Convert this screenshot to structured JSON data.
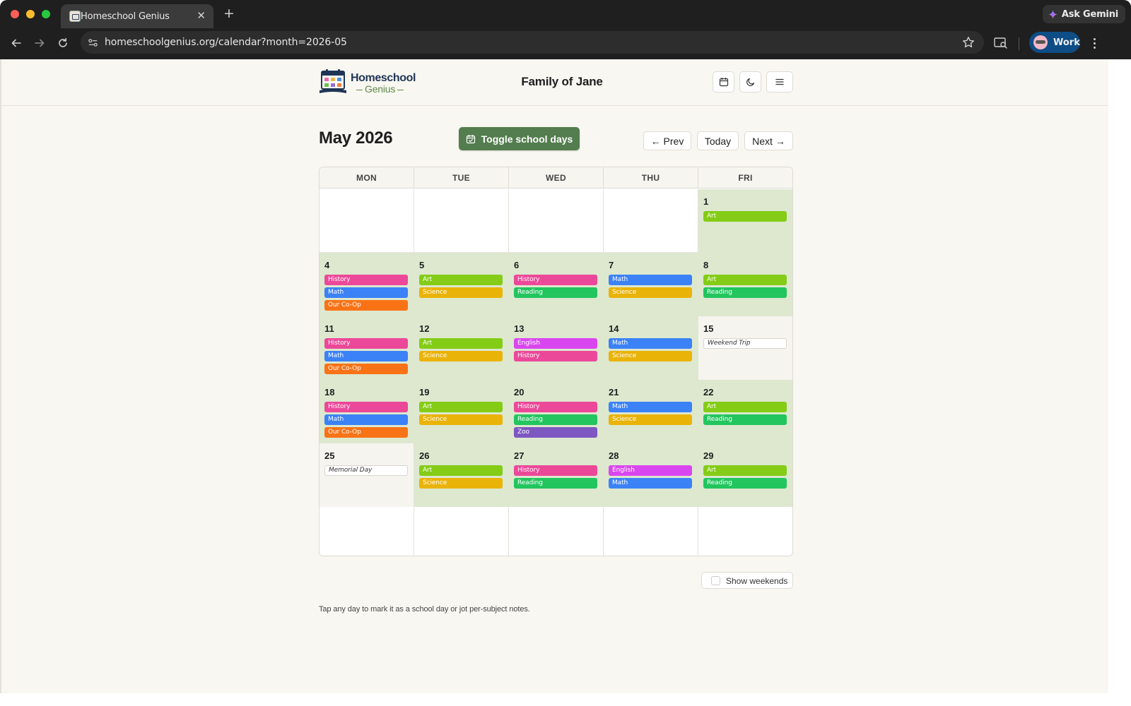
{
  "browser": {
    "tab_title": "Homeschool Genius",
    "tab_close": "✕",
    "new_tab": "+",
    "gemini_label": "Ask Gemini",
    "url": "homeschoolgenius.org/calendar?month=2026-05",
    "profile_label": "Work"
  },
  "header": {
    "logo_line1": "Homeschool",
    "logo_line2": "Genius",
    "family_name": "Family of Jane",
    "icons": [
      "calendar-icon",
      "moon-icon",
      "menu-icon"
    ]
  },
  "calendar": {
    "month_title": "May 2026",
    "toggle_label": "Toggle school days",
    "prev_label": "← Prev",
    "today_label": "Today",
    "next_label": "Next →",
    "weekdays": [
      "MON",
      "TUE",
      "WED",
      "THU",
      "FRI"
    ],
    "weeks": [
      [
        {
          "day": "",
          "type": "blank",
          "chips": []
        },
        {
          "day": "",
          "type": "blank",
          "chips": []
        },
        {
          "day": "",
          "type": "blank",
          "chips": []
        },
        {
          "day": "",
          "type": "blank",
          "chips": []
        },
        {
          "day": "1",
          "type": "school",
          "chips": [
            {
              "label": "Art",
              "subject": "art"
            }
          ]
        }
      ],
      [
        {
          "day": "4",
          "type": "school",
          "chips": [
            {
              "label": "History",
              "subject": "history"
            },
            {
              "label": "Math",
              "subject": "math"
            },
            {
              "label": "Our Co-Op",
              "subject": "coop"
            }
          ]
        },
        {
          "day": "5",
          "type": "school",
          "chips": [
            {
              "label": "Art",
              "subject": "art"
            },
            {
              "label": "Science",
              "subject": "science"
            }
          ]
        },
        {
          "day": "6",
          "type": "school",
          "chips": [
            {
              "label": "History",
              "subject": "history"
            },
            {
              "label": "Reading",
              "subject": "reading"
            }
          ]
        },
        {
          "day": "7",
          "type": "school",
          "chips": [
            {
              "label": "Math",
              "subject": "math"
            },
            {
              "label": "Science",
              "subject": "science"
            }
          ]
        },
        {
          "day": "8",
          "type": "school",
          "chips": [
            {
              "label": "Art",
              "subject": "art"
            },
            {
              "label": "Reading",
              "subject": "reading"
            }
          ]
        }
      ],
      [
        {
          "day": "11",
          "type": "school",
          "chips": [
            {
              "label": "History",
              "subject": "history"
            },
            {
              "label": "Math",
              "subject": "math"
            },
            {
              "label": "Our Co-Op",
              "subject": "coop"
            }
          ]
        },
        {
          "day": "12",
          "type": "school",
          "chips": [
            {
              "label": "Art",
              "subject": "art"
            },
            {
              "label": "Science",
              "subject": "science"
            }
          ]
        },
        {
          "day": "13",
          "type": "school",
          "chips": [
            {
              "label": "English",
              "subject": "english"
            },
            {
              "label": "History",
              "subject": "history"
            }
          ]
        },
        {
          "day": "14",
          "type": "school",
          "chips": [
            {
              "label": "Math",
              "subject": "math"
            },
            {
              "label": "Science",
              "subject": "science"
            }
          ]
        },
        {
          "day": "15",
          "type": "offday",
          "chips": [
            {
              "label": "Weekend Trip",
              "subject": "note"
            }
          ]
        }
      ],
      [
        {
          "day": "18",
          "type": "school",
          "chips": [
            {
              "label": "History",
              "subject": "history"
            },
            {
              "label": "Math",
              "subject": "math"
            },
            {
              "label": "Our Co-Op",
              "subject": "coop"
            }
          ]
        },
        {
          "day": "19",
          "type": "school",
          "chips": [
            {
              "label": "Art",
              "subject": "art"
            },
            {
              "label": "Science",
              "subject": "science"
            }
          ]
        },
        {
          "day": "20",
          "type": "school",
          "chips": [
            {
              "label": "History",
              "subject": "history"
            },
            {
              "label": "Reading",
              "subject": "reading"
            },
            {
              "label": "Zoo",
              "subject": "zoo"
            }
          ]
        },
        {
          "day": "21",
          "type": "school",
          "chips": [
            {
              "label": "Math",
              "subject": "math"
            },
            {
              "label": "Science",
              "subject": "science"
            }
          ]
        },
        {
          "day": "22",
          "type": "school",
          "chips": [
            {
              "label": "Art",
              "subject": "art"
            },
            {
              "label": "Reading",
              "subject": "reading"
            }
          ]
        }
      ],
      [
        {
          "day": "25",
          "type": "offday",
          "chips": [
            {
              "label": "Memorial Day",
              "subject": "note"
            }
          ]
        },
        {
          "day": "26",
          "type": "school",
          "chips": [
            {
              "label": "Art",
              "subject": "art"
            },
            {
              "label": "Science",
              "subject": "science"
            }
          ]
        },
        {
          "day": "27",
          "type": "school",
          "chips": [
            {
              "label": "History",
              "subject": "history"
            },
            {
              "label": "Reading",
              "subject": "reading"
            }
          ]
        },
        {
          "day": "28",
          "type": "school",
          "chips": [
            {
              "label": "English",
              "subject": "english"
            },
            {
              "label": "Math",
              "subject": "math"
            }
          ]
        },
        {
          "day": "29",
          "type": "school",
          "chips": [
            {
              "label": "Art",
              "subject": "art"
            },
            {
              "label": "Reading",
              "subject": "reading"
            }
          ]
        }
      ],
      [
        {
          "day": "",
          "type": "blank",
          "chips": []
        },
        {
          "day": "",
          "type": "blank",
          "chips": []
        },
        {
          "day": "",
          "type": "blank",
          "chips": []
        },
        {
          "day": "",
          "type": "blank",
          "chips": []
        },
        {
          "day": "",
          "type": "blank",
          "chips": []
        }
      ]
    ],
    "subject_colors": {
      "art": "#84cc16",
      "science": "#eab308",
      "history": "#ec4899",
      "math": "#3b82f6",
      "coop": "#f97316",
      "reading": "#22c55e",
      "english": "#d946ef",
      "zoo": "#7e57c2"
    },
    "school_day_color": "#dde8cf",
    "show_weekends_label": "Show weekends",
    "show_weekends_checked": false,
    "hint": "Tap any day to mark it as a school day or jot per-subject notes."
  }
}
